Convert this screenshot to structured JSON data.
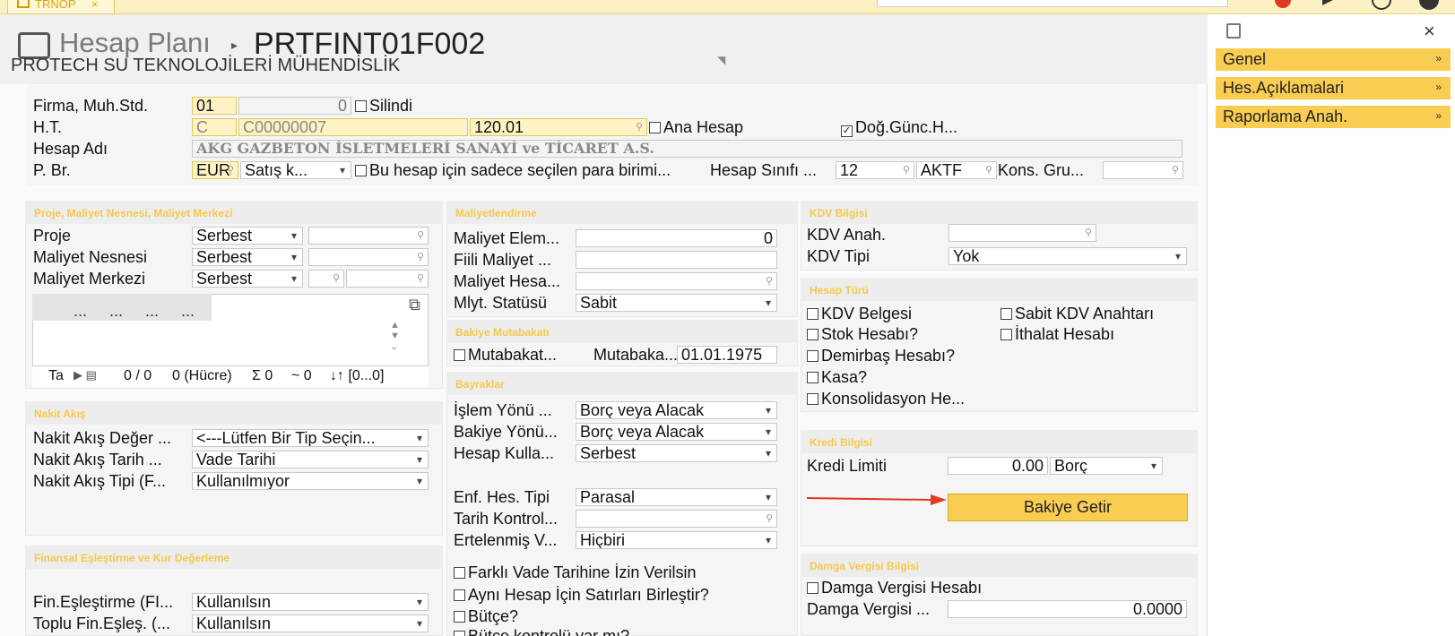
{
  "tab": {
    "label": "TRNOP"
  },
  "header": {
    "title_prefix": "Hesap Planı",
    "title_code": "PRTFINT01F002",
    "company": "PROTECH SU TEKNOLOJİLERİ MÜHENDİSLİK"
  },
  "general": {
    "firma_label": "Firma, Muh.Std.",
    "firma_value": "01",
    "muhstd_value": "0",
    "silindi_label": "Silindi",
    "ht_label": "H.T.",
    "ht_type": "C",
    "ht_code": "C00000007",
    "ht_account": "120.01",
    "ana_hesap_label": "Ana Hesap",
    "dog_gunc_label": "Doğ.Günc.H...",
    "hesap_adi_label": "Hesap Adı",
    "hesap_adi_value": "AKG GAZBETON İSLETMELERİ SANAYİ ve TİCARET A.S.",
    "pbr_label": "P. Br.",
    "pbr_value": "EUR",
    "satis_value": "Satış k...",
    "bu_hesap_label": "Bu hesap için sadece seçilen para birimi...",
    "hesap_sinifi_label": "Hesap Sınıfı ...",
    "hesap_sinifi_value": "12",
    "aktf_value": "AKTF",
    "kons_label": "Kons. Gru..."
  },
  "proje": {
    "title": "Proje, Maliyet Nesnesi, Maliyet Merkezi",
    "proje_label": "Proje",
    "proje_value": "Serbest",
    "nesne_label": "Maliyet Nesnesi",
    "nesne_value": "Serbest",
    "merkez_label": "Maliyet Merkezi",
    "merkez_value": "Serbest",
    "grid_cols": [
      "...",
      "...",
      "...",
      "..."
    ],
    "grid_footer": {
      "ta": "Ta",
      "count": "0 / 0",
      "cells": "0 (Hücre)",
      "sum": "Σ 0",
      "avg": "~ 0",
      "range": "↓↑ [0...0]"
    }
  },
  "nakit": {
    "title": "Nakit Akış",
    "deger_label": "Nakit Akış Değer ...",
    "deger_value": "<---Lütfen Bir Tip Seçin...",
    "tarih_label": "Nakit Akış Tarih ...",
    "tarih_value": "Vade Tarihi",
    "tipi_label": "Nakit Akış Tipi (F...",
    "tipi_value": "Kullanılmıyor"
  },
  "finans": {
    "title": "Finansal Eşleştirme ve Kur Değerleme",
    "fin_label": "Fin.Eşleştirme (FI...",
    "fin_value": "Kullanılsın",
    "toplu_label": "Toplu Fin.Eşleş. (...",
    "toplu_value": "Kullanılsın"
  },
  "maliyet": {
    "title": "Maliyetlendirme",
    "elem_label": "Maliyet Elem...",
    "elem_value": "0",
    "fiili_label": "Fiili Maliyet ...",
    "hesa_label": "Maliyet Hesa...",
    "status_label": "Mlyt. Statüsü",
    "status_value": "Sabit"
  },
  "mutabakat": {
    "title": "Bakiye Mutabakatı",
    "mut_label": "Mutabakat...",
    "mutabaka_label": "Mutabaka...",
    "mutabaka_date": "01.01.1975"
  },
  "bayraklar": {
    "title": "Bayraklar",
    "islem_label": "İşlem Yönü ...",
    "islem_value": "Borç veya Alacak",
    "bakiye_label": "Bakiye Yönü...",
    "bakiye_value": "Borç veya Alacak",
    "kulla_label": "Hesap Kulla...",
    "kulla_value": "Serbest",
    "enf_label": "Enf. Hes. Tipi",
    "enf_value": "Parasal",
    "tarih_label": "Tarih Kontrol...",
    "ertelenmis_label": "Ertelenmiş V...",
    "ertelenmis_value": "Hiçbiri",
    "farkli_label": "Farklı Vade Tarihine İzin Verilsin",
    "ayni_label": "Aynı Hesap İçin Satırları Birleştir?",
    "butce_label": "Bütçe?",
    "butce_kontrol_label": "Bütçe kontrolü var mı?"
  },
  "kdv": {
    "title": "KDV Bilgisi",
    "anah_label": "KDV Anah.",
    "tipi_label": "KDV Tipi",
    "tipi_value": "Yok"
  },
  "hesap_turu": {
    "title": "Hesap Türü",
    "kdv_belgesi": "KDV Belgesi",
    "sabit_kdv": "Sabit KDV Anahtarı",
    "stok": "Stok Hesabı?",
    "ithalat": "İthalat Hesabı",
    "demirbas": "Demirbaş Hesabı?",
    "kasa": "Kasa?",
    "konsolidasyon": "Konsolidasyon He..."
  },
  "kredi": {
    "title": "Kredi Bilgisi",
    "limit_label": "Kredi Limiti",
    "limit_value": "0.00",
    "borc_value": "Borç",
    "bakiye_button": "Bakiye Getir"
  },
  "damga": {
    "title": "Damga Vergisi Bilgisi",
    "hesabi_label": "Damga Vergisi Hesabı",
    "value_label": "Damga Vergisi ...",
    "value": "0.0000"
  },
  "sidebar": {
    "items": [
      {
        "label": "Genel"
      },
      {
        "label": "Hes.Açıklamalari"
      },
      {
        "label": "Raporlama Anah."
      }
    ]
  },
  "colors": {
    "accent": "#f9cd51",
    "field_yellow": "#fff3c6",
    "arrow": "#e03a22"
  }
}
